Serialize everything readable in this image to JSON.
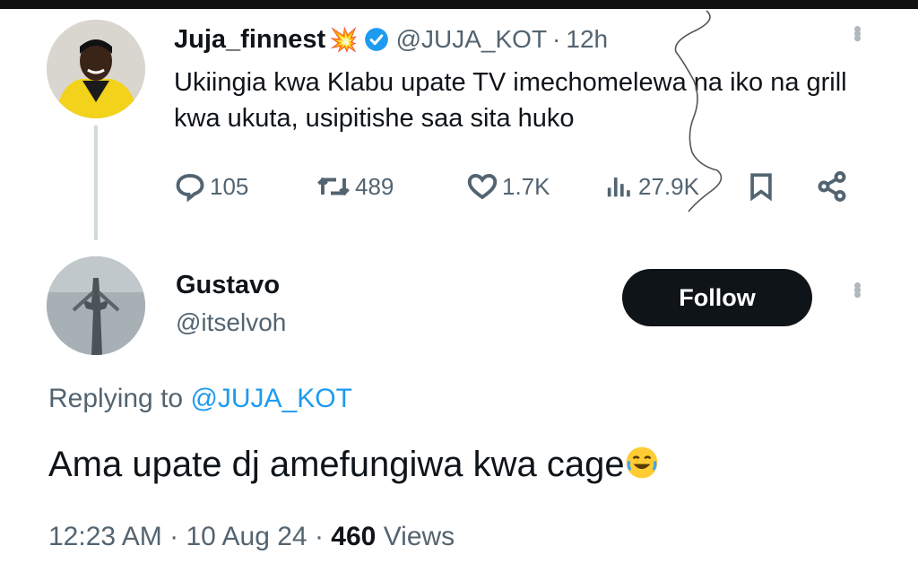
{
  "parent_tweet": {
    "display_name": "Juja_finnest",
    "emoji": "💥",
    "handle": "@JUJA_KOT",
    "separator": "·",
    "time": "12h",
    "text": "Ukiingia kwa Klabu upate TV imechomelewa na iko na grill kwa ukuta, usipitishe saa sita huko",
    "stats": {
      "replies": "105",
      "reposts": "489",
      "likes": "1.7K",
      "views": "27.9K"
    }
  },
  "reply": {
    "display_name": "Gustavo",
    "handle": "@itselvoh",
    "follow_label": "Follow",
    "replying_prefix": "Replying to",
    "replying_to": "@JUJA_KOT",
    "text": "Ama upate dj amefungiwa kwa cage",
    "time": "12:23 AM",
    "separator": "·",
    "date": "10 Aug 24",
    "views_count": "460",
    "views_label": "Views"
  },
  "colors": {
    "text": "#0f1419",
    "secondary": "#536471",
    "accent": "#1d9bf0",
    "follow_bg": "#0f1419"
  },
  "icons": [
    "verified-badge-icon",
    "reply-icon",
    "repost-icon",
    "like-icon",
    "views-icon",
    "bookmark-icon",
    "share-icon",
    "more-icon",
    "laughing-emoji-icon"
  ]
}
